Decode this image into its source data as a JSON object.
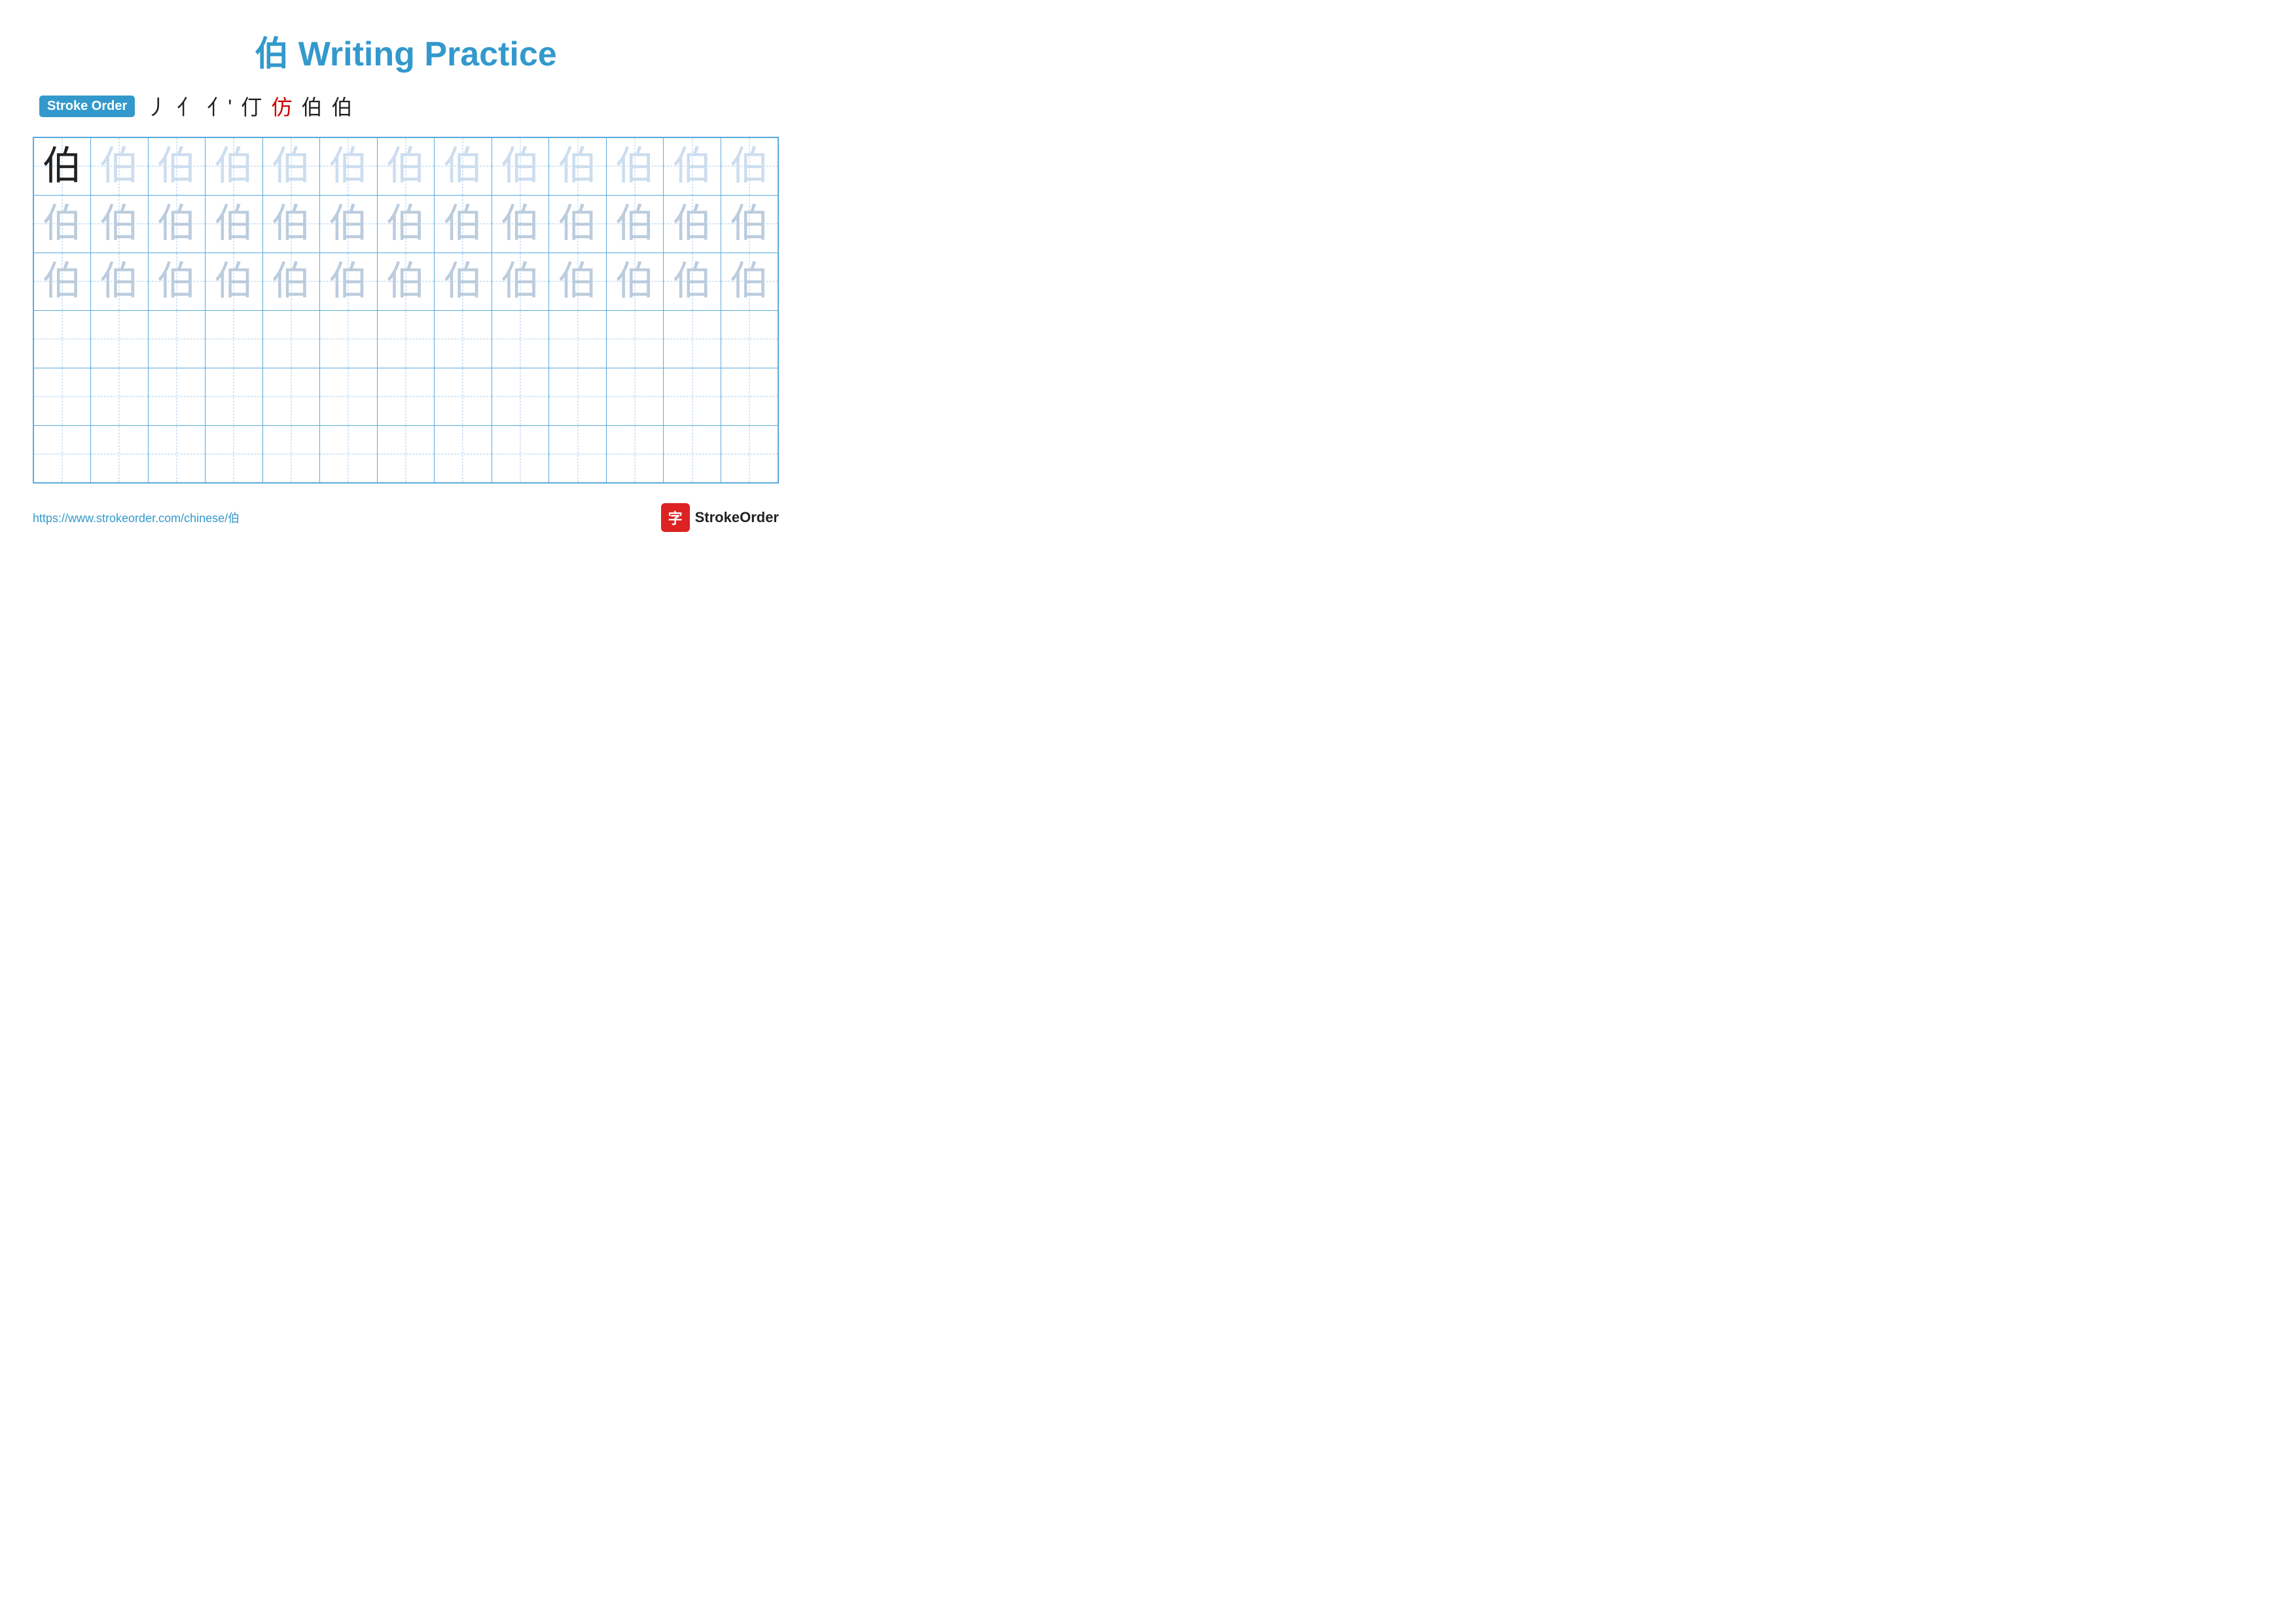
{
  "title": "伯 Writing Practice",
  "stroke_order": {
    "label": "Stroke Order",
    "sequence": [
      "丿",
      "亻",
      "亻'",
      "仃",
      "仿",
      "伯",
      "伯"
    ]
  },
  "character": "伯",
  "grid": {
    "rows": 6,
    "cols": 13
  },
  "footer": {
    "url": "https://www.strokeorder.com/chinese/伯",
    "logo_text": "StrokeOrder",
    "logo_icon": "字"
  }
}
